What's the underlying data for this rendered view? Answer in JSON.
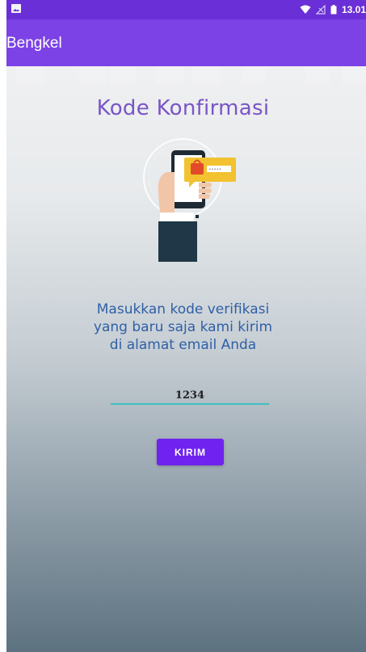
{
  "statusbar": {
    "time": "13.01",
    "icons": [
      "image-icon",
      "wifi-icon",
      "signal-icon",
      "battery-icon"
    ]
  },
  "toolbar": {
    "title": "Bengkel"
  },
  "screen": {
    "title": "Kode Konfirmasi",
    "illustration_icon": "phone-lock-verification-illustration",
    "instruction_lines": [
      "Masukkan kode verifikasi",
      "yang baru saja kami kirim",
      "di alamat email Anda"
    ],
    "code_input_value": "1234",
    "submit_label": "KIRIM"
  },
  "colors": {
    "statusbar": "#6a2fd6",
    "toolbar": "#7c42e6",
    "accent": "#6f22f0",
    "title_text": "#7a55c6",
    "instruction_text": "#2f5fa6",
    "input_underline": "#3dbfc1"
  }
}
